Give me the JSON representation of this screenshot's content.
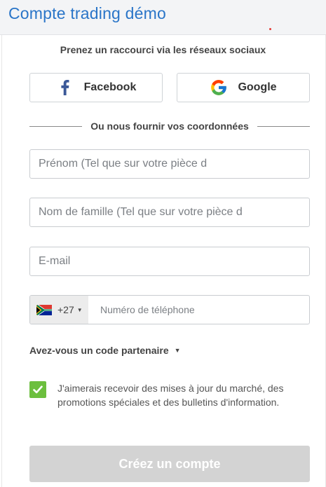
{
  "header": {
    "title": "Compte trading démo"
  },
  "social": {
    "title": "Prenez un raccourci via les réseaux sociaux",
    "facebook_label": "Facebook",
    "google_label": "Google"
  },
  "divider": {
    "text": "Ou nous fournir vos coordonnées"
  },
  "form": {
    "firstname_placeholder": "Prénom (Tel que sur votre pièce d",
    "lastname_placeholder": "Nom de famille (Tel que sur votre pièce d",
    "email_placeholder": "E-mail",
    "phone": {
      "country_code": "+27",
      "country_flag": "south-africa-flag-icon",
      "placeholder": "Numéro de téléphone"
    },
    "partner_label": "Avez-vous un code partenaire",
    "consent": {
      "checked": true,
      "text": "J'aimerais recevoir des mises à jour du marché, des promotions spéciales et des bulletins d'information."
    },
    "submit_label": "Créez un compte"
  },
  "colors": {
    "brand": "#2a75c8",
    "checkbox": "#6cbf3e",
    "submit_disabled": "#d3d3d3",
    "facebook": "#3b5998"
  }
}
